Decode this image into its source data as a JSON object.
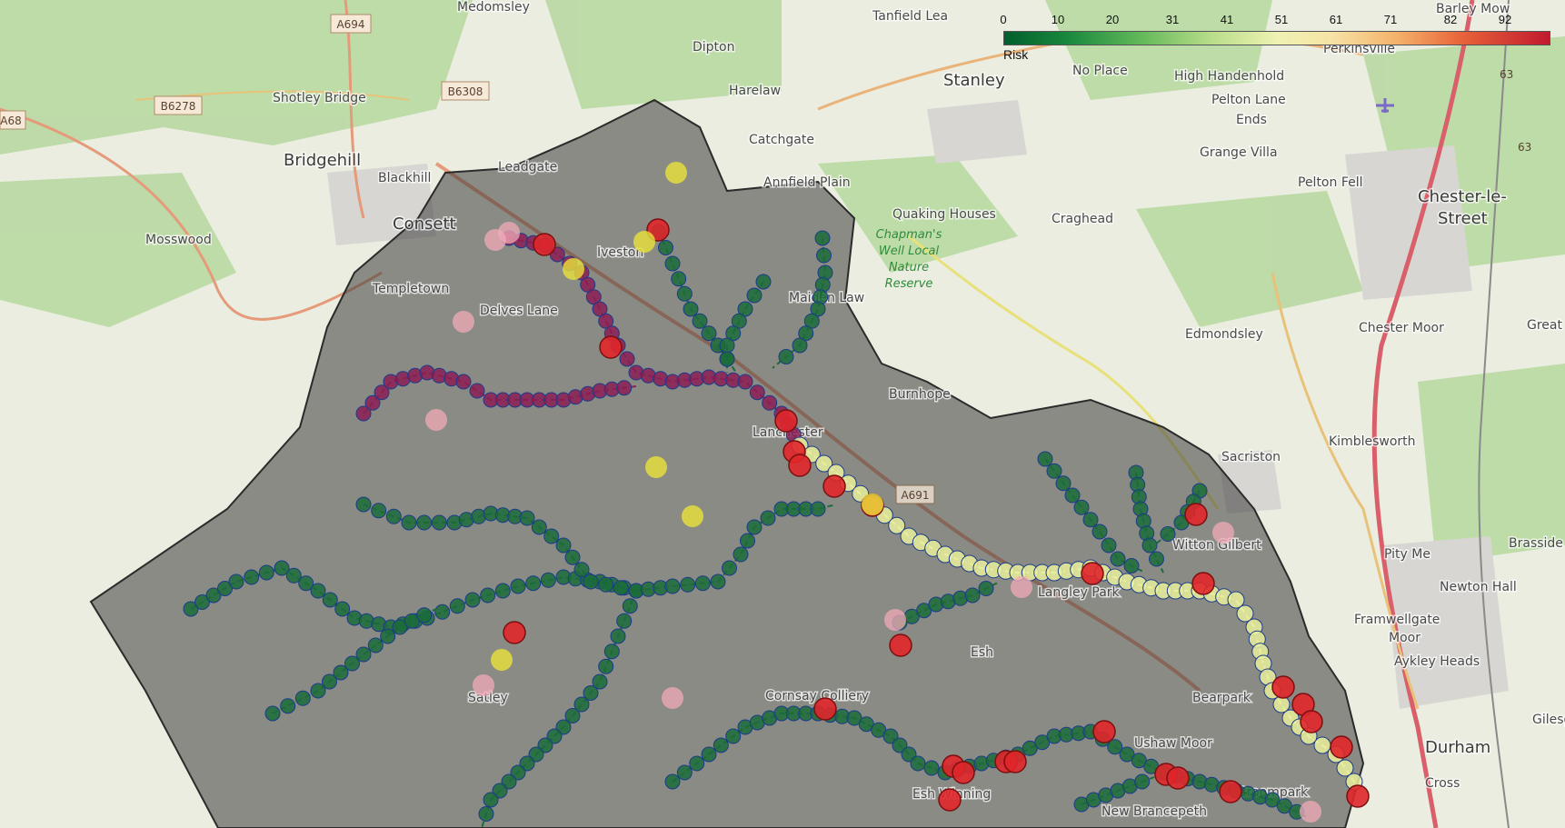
{
  "map": {
    "places": {
      "medomsley": "Medomsley",
      "tanfield_lea": "Tanfield Lea",
      "barley_mow": "Barley Mow",
      "dipton": "Dipton",
      "harelaw": "Harelaw",
      "shotley_bridge": "Shotley Bridge",
      "stanley": "Stanley",
      "no_place": "No Place",
      "high_handenhold": "High Handenhold",
      "perkinsville": "Perkinsville",
      "pelton_lane_ends_1": "Pelton Lane",
      "pelton_lane_ends_2": "Ends",
      "catchgate": "Catchgate",
      "bridgehill": "Bridgehill",
      "blackhill": "Blackhill",
      "leadgate": "Leadgate",
      "annfield_plain": "Annfield Plain",
      "grange_villa": "Grange Villa",
      "pelton_fell": "Pelton Fell",
      "chester_le_street_1": "Chester-le-",
      "chester_le_street_2": "Street",
      "consett": "Consett",
      "mosswood": "Mosswood",
      "quaking_houses": "Quaking Houses",
      "craghead": "Craghead",
      "iveston": "Iveston",
      "templetown": "Templetown",
      "delves_lane": "Delves Lane",
      "maiden_law": "Maiden Law",
      "edmondsley": "Edmondsley",
      "chester_moor": "Chester Moor",
      "great": "Great",
      "burnhope": "Burnhope",
      "lanchester": "Lanchester",
      "kimblesworth": "Kimblesworth",
      "sacriston": "Sacriston",
      "witton_gilbert": "Witton Gilbert",
      "brasside": "Brasside",
      "pity_me": "Pity Me",
      "newton_hall": "Newton Hall",
      "langley_park": "Langley Park",
      "framwellgate_moor_1": "Framwellgate",
      "framwellgate_moor_2": "Moor",
      "aykley_heads": "Aykley Heads",
      "esh": "Esh",
      "satley": "Satley",
      "cornsay_colliery": "Cornsay Colliery",
      "bearpark": "Bearpark",
      "ushaw_moor": "Ushaw Moor",
      "durham": "Durham",
      "gilesgate": "Gilesg",
      "esh_winning": "Esh Winning",
      "broompark": "Broompark",
      "new_brancepeth": "New Brancepeth",
      "cross": "Cross"
    },
    "park_label": [
      "Chapman's",
      "Well Local",
      "Nature",
      "Reserve"
    ],
    "road_refs": {
      "a694": "A694",
      "a68": "A68",
      "b6278": "B6278",
      "b6308": "B6308",
      "a691": "A691",
      "r63a": "63",
      "r63b": "63"
    }
  },
  "legend": {
    "title": "Risk",
    "ticks": [
      "0",
      "10",
      "20",
      "31",
      "41",
      "51",
      "61",
      "71",
      "82",
      "92"
    ],
    "tick_values": [
      0,
      10,
      20,
      31,
      41,
      51,
      61,
      71,
      82,
      92
    ],
    "min": 0,
    "max": 100,
    "colors": [
      "#005f2c",
      "#1a8a3e",
      "#63b85a",
      "#b9dd8a",
      "#eef2b2",
      "#f7e3a6",
      "#f4b26a",
      "#e8623a",
      "#c01a2e"
    ]
  },
  "colors": {
    "low_risk": "#1b6b3a",
    "mid_risk": "#e9ef9c",
    "high_risk": "#e0262a",
    "catchment_mask": "#404040"
  }
}
